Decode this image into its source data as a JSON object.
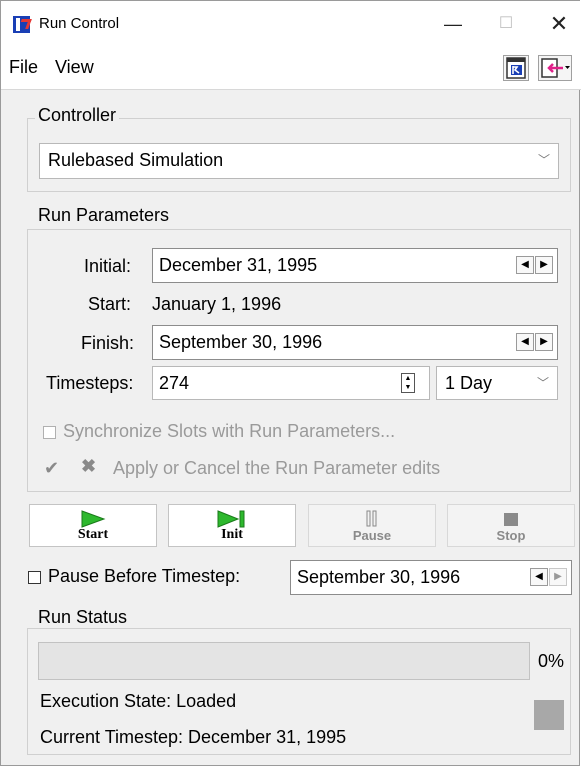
{
  "window": {
    "title": "Run Control",
    "minimize": "—",
    "maximize": "☐",
    "close": "✕"
  },
  "menu": {
    "file": "File",
    "view": "View"
  },
  "toolbar": {
    "run_icon": "run-icon",
    "output_icon": "pink-arrow-icon"
  },
  "controller": {
    "group_title": "Controller",
    "selected": "Rulebased Simulation"
  },
  "run_parameters": {
    "group_title": "Run Parameters",
    "initial_label": "Initial:",
    "initial_value": "December 31, 1995",
    "start_label": "Start:",
    "start_value": "January 1, 1996",
    "finish_label": "Finish:",
    "finish_value": "September 30, 1996",
    "timesteps_label": "Timesteps:",
    "timesteps_value": "274",
    "timestep_unit": "1 Day",
    "sync_label": "Synchronize Slots with Run Parameters...",
    "apply_label": "Apply or Cancel the Run Parameter edits"
  },
  "controls": {
    "start": "Start",
    "init": "Init",
    "pause": "Pause",
    "stop": "Stop"
  },
  "pause_before": {
    "label": "Pause Before Timestep:",
    "value": "September 30, 1996"
  },
  "run_status": {
    "group_title": "Run Status",
    "progress_percent": 0,
    "progress_text": "0%",
    "execution_state": "Execution State: Loaded",
    "current_timestep": "Current Timestep: December 31, 1995"
  },
  "colors": {
    "play_green": "#2db82d",
    "disabled_gray": "#9a9a9a",
    "status_gray": "#a8a8a8",
    "brand_blue": "#1a3fb5"
  }
}
